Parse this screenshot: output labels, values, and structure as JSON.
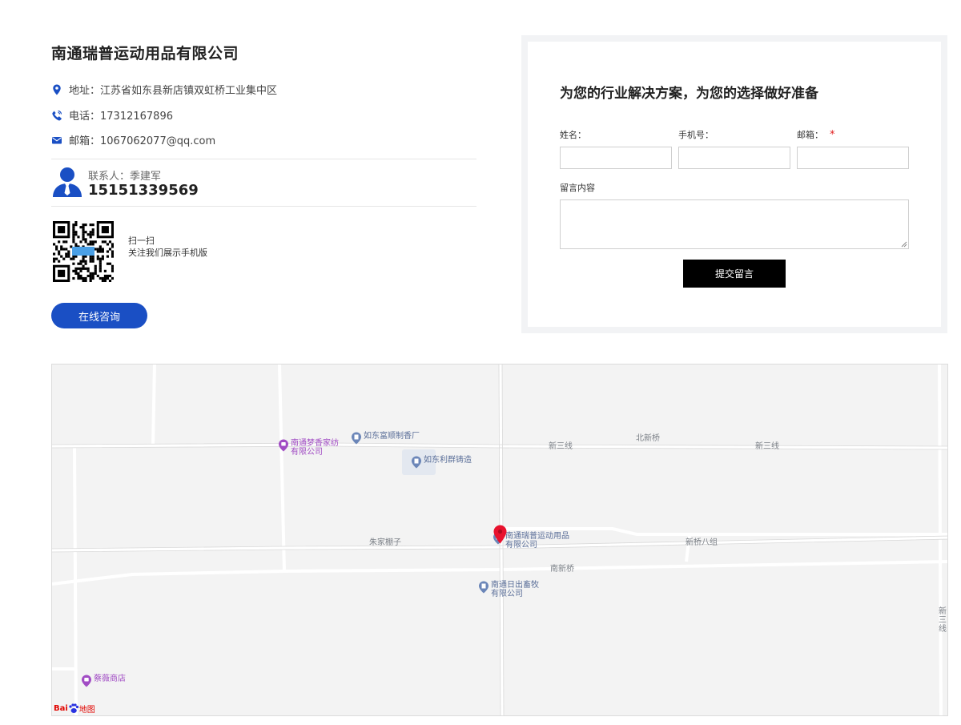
{
  "company": {
    "name": "南通瑞普运动用品有限公司",
    "address": "地址：江苏省如东县新店镇双虹桥工业集中区",
    "phone": "电话：17312167896",
    "email": "邮箱：1067062077@qq.com",
    "contact_label": "联系人：季建军",
    "contact_phone": "15151339569",
    "qr_line1": "扫一扫",
    "qr_line2": "关注我们展示手机版",
    "consult_button": "在线咨询"
  },
  "form": {
    "title": "为您的行业解决方案，为您的选择做好准备",
    "name_label": "姓名：",
    "mobile_label": "手机号：",
    "email_label": "邮箱：",
    "required_mark": "*",
    "message_label": "留言内容",
    "name_value": "",
    "mobile_value": "",
    "email_value": "",
    "message_value": "",
    "submit_label": "提交留言"
  },
  "map": {
    "roads": {
      "xinsanxian_1": "新三线",
      "xinsanxian_2": "新三线",
      "beixinqiao": "北新桥",
      "zhujiapengzi": "朱家棚子",
      "xinqiaobazu": "新桥八组",
      "nanxinqiao": "南新桥",
      "xinsanxian_vertical": "新三线"
    },
    "pois": {
      "mengxiang_1": "南通梦香家纺",
      "mengxiang_2": "有限公司",
      "fuhui": "如东富顺制香厂",
      "lichen": "如东利群铸造",
      "ruipu_1": "南通瑞普运动用品",
      "ruipu_2": "有限公司",
      "richu_1": "南通日出畜牧",
      "richu_2": "有限公司",
      "caiwei": "蔡薇商店"
    },
    "logo_bai": "Bai",
    "logo_du": "du",
    "logo_map": "地图"
  },
  "colors": {
    "accent_blue": "#1a4fc4",
    "required_red": "#e01b1b",
    "poi_purple": "#a14cc4",
    "poi_blue": "#5b6f99",
    "marker_red": "#e8112d"
  }
}
